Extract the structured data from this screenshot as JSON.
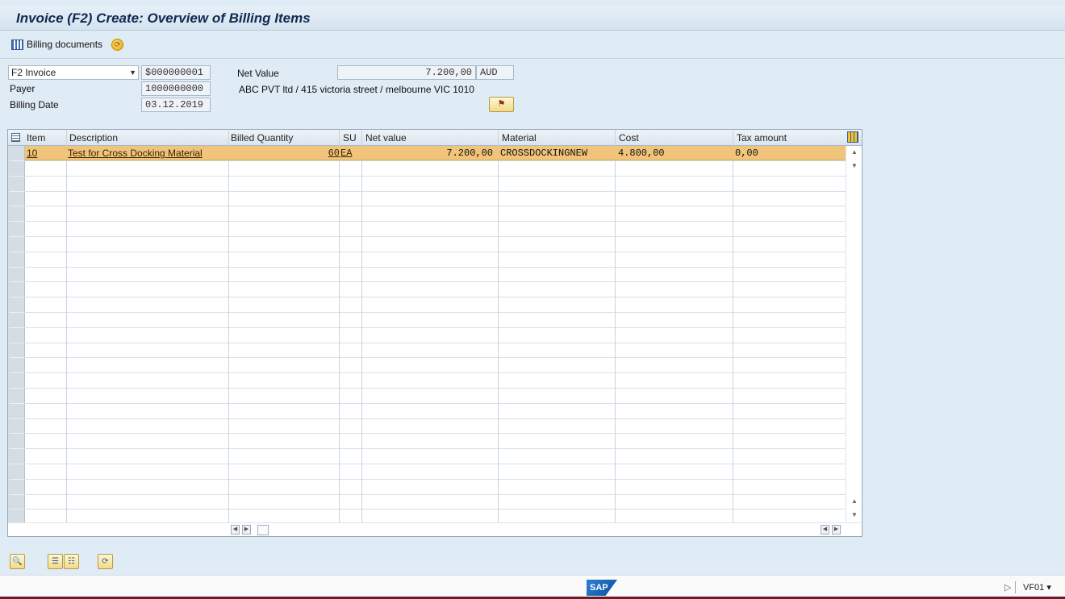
{
  "window": {
    "title": "Invoice  (F2) Create: Overview of Billing Items"
  },
  "toolbar": {
    "billing_documents_label": "Billing documents"
  },
  "header": {
    "billing_type": "F2 Invoice",
    "document_number": "$000000001",
    "payer_label": "Payer",
    "payer_value": "1000000000",
    "billing_date_label": "Billing Date",
    "billing_date_value": "03.12.2019",
    "net_value_label": "Net Value",
    "net_value": "7.200,00",
    "currency": "AUD",
    "payer_address": "ABC PVT ltd / 415 victoria street / melbourne VIC 1010"
  },
  "table": {
    "columns": [
      "Item",
      "Description",
      "Billed Quantity",
      "SU",
      "Net value",
      "Material",
      "Cost",
      "Tax amount"
    ],
    "rows": [
      {
        "item": "10",
        "description": "Test  for Cross Docking Material",
        "billed_quantity": "60",
        "su": "EA",
        "net_value": "7.200,00",
        "material": "CROSSDOCKINGNEW",
        "cost": "4.800,00",
        "tax_amount": "0,00"
      }
    ]
  },
  "statusbar": {
    "transaction": "VF01"
  },
  "colors": {
    "selected_row": "#f0c57b",
    "title_text": "#0e2a4e",
    "background": "#dfebf5"
  }
}
